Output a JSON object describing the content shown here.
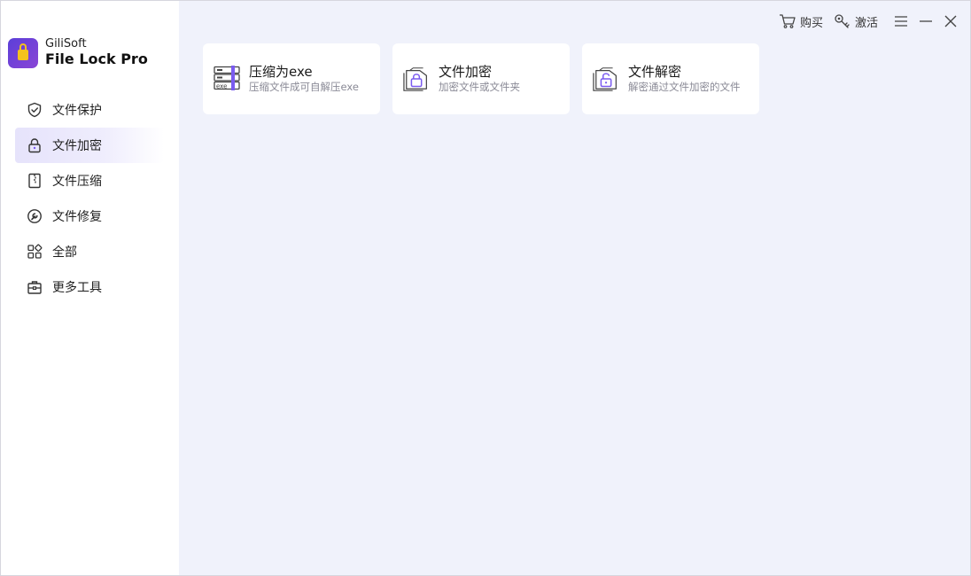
{
  "brand": {
    "company": "GiliSoft",
    "product": "File Lock Pro"
  },
  "sidebar": {
    "items": [
      {
        "label": "文件保护",
        "icon": "shield-icon",
        "active": false
      },
      {
        "label": "文件加密",
        "icon": "lock-icon",
        "active": true
      },
      {
        "label": "文件压缩",
        "icon": "zip-file-icon",
        "active": false
      },
      {
        "label": "文件修复",
        "icon": "wrench-icon",
        "active": false
      },
      {
        "label": "全部",
        "icon": "grid-icon",
        "active": false
      },
      {
        "label": "更多工具",
        "icon": "toolbox-icon",
        "active": false
      }
    ]
  },
  "topbar": {
    "buy_label": "购买",
    "activate_label": "激活"
  },
  "cards": [
    {
      "title": "压缩为exe",
      "desc": "压缩文件成可自解压exe",
      "icon": "exe-archive-icon"
    },
    {
      "title": "文件加密",
      "desc": "加密文件或文件夹",
      "icon": "file-lock-icon"
    },
    {
      "title": "文件解密",
      "desc": "解密通过文件加密的文件",
      "icon": "file-unlock-icon"
    }
  ],
  "colors": {
    "accent": "#7b5cf0",
    "main_bg": "#f0f2fb",
    "active_bg": "#e6e3fb"
  }
}
